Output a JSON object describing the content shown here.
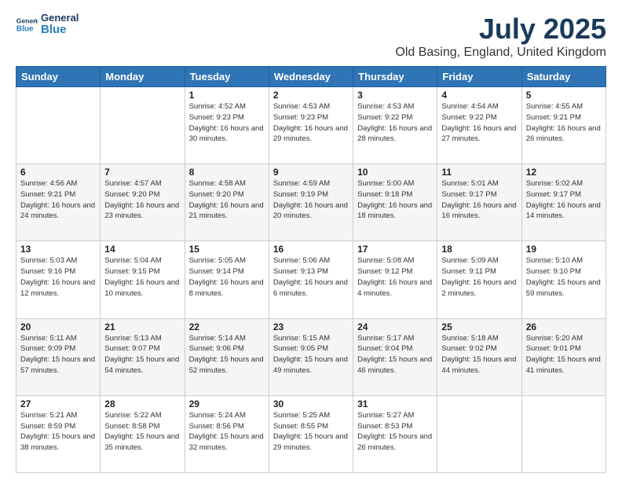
{
  "logo": {
    "line1": "General",
    "line2": "Blue"
  },
  "title": "July 2025",
  "subtitle": "Old Basing, England, United Kingdom",
  "weekdays": [
    "Sunday",
    "Monday",
    "Tuesday",
    "Wednesday",
    "Thursday",
    "Friday",
    "Saturday"
  ],
  "weeks": [
    [
      {
        "day": "",
        "info": ""
      },
      {
        "day": "",
        "info": ""
      },
      {
        "day": "1",
        "info": "Sunrise: 4:52 AM\nSunset: 9:23 PM\nDaylight: 16 hours and 30 minutes."
      },
      {
        "day": "2",
        "info": "Sunrise: 4:53 AM\nSunset: 9:23 PM\nDaylight: 16 hours and 29 minutes."
      },
      {
        "day": "3",
        "info": "Sunrise: 4:53 AM\nSunset: 9:22 PM\nDaylight: 16 hours and 28 minutes."
      },
      {
        "day": "4",
        "info": "Sunrise: 4:54 AM\nSunset: 9:22 PM\nDaylight: 16 hours and 27 minutes."
      },
      {
        "day": "5",
        "info": "Sunrise: 4:55 AM\nSunset: 9:21 PM\nDaylight: 16 hours and 26 minutes."
      }
    ],
    [
      {
        "day": "6",
        "info": "Sunrise: 4:56 AM\nSunset: 9:21 PM\nDaylight: 16 hours and 24 minutes."
      },
      {
        "day": "7",
        "info": "Sunrise: 4:57 AM\nSunset: 9:20 PM\nDaylight: 16 hours and 23 minutes."
      },
      {
        "day": "8",
        "info": "Sunrise: 4:58 AM\nSunset: 9:20 PM\nDaylight: 16 hours and 21 minutes."
      },
      {
        "day": "9",
        "info": "Sunrise: 4:59 AM\nSunset: 9:19 PM\nDaylight: 16 hours and 20 minutes."
      },
      {
        "day": "10",
        "info": "Sunrise: 5:00 AM\nSunset: 9:18 PM\nDaylight: 16 hours and 18 minutes."
      },
      {
        "day": "11",
        "info": "Sunrise: 5:01 AM\nSunset: 9:17 PM\nDaylight: 16 hours and 16 minutes."
      },
      {
        "day": "12",
        "info": "Sunrise: 5:02 AM\nSunset: 9:17 PM\nDaylight: 16 hours and 14 minutes."
      }
    ],
    [
      {
        "day": "13",
        "info": "Sunrise: 5:03 AM\nSunset: 9:16 PM\nDaylight: 16 hours and 12 minutes."
      },
      {
        "day": "14",
        "info": "Sunrise: 5:04 AM\nSunset: 9:15 PM\nDaylight: 16 hours and 10 minutes."
      },
      {
        "day": "15",
        "info": "Sunrise: 5:05 AM\nSunset: 9:14 PM\nDaylight: 16 hours and 8 minutes."
      },
      {
        "day": "16",
        "info": "Sunrise: 5:06 AM\nSunset: 9:13 PM\nDaylight: 16 hours and 6 minutes."
      },
      {
        "day": "17",
        "info": "Sunrise: 5:08 AM\nSunset: 9:12 PM\nDaylight: 16 hours and 4 minutes."
      },
      {
        "day": "18",
        "info": "Sunrise: 5:09 AM\nSunset: 9:11 PM\nDaylight: 16 hours and 2 minutes."
      },
      {
        "day": "19",
        "info": "Sunrise: 5:10 AM\nSunset: 9:10 PM\nDaylight: 15 hours and 59 minutes."
      }
    ],
    [
      {
        "day": "20",
        "info": "Sunrise: 5:11 AM\nSunset: 9:09 PM\nDaylight: 15 hours and 57 minutes."
      },
      {
        "day": "21",
        "info": "Sunrise: 5:13 AM\nSunset: 9:07 PM\nDaylight: 15 hours and 54 minutes."
      },
      {
        "day": "22",
        "info": "Sunrise: 5:14 AM\nSunset: 9:06 PM\nDaylight: 15 hours and 52 minutes."
      },
      {
        "day": "23",
        "info": "Sunrise: 5:15 AM\nSunset: 9:05 PM\nDaylight: 15 hours and 49 minutes."
      },
      {
        "day": "24",
        "info": "Sunrise: 5:17 AM\nSunset: 9:04 PM\nDaylight: 15 hours and 46 minutes."
      },
      {
        "day": "25",
        "info": "Sunrise: 5:18 AM\nSunset: 9:02 PM\nDaylight: 15 hours and 44 minutes."
      },
      {
        "day": "26",
        "info": "Sunrise: 5:20 AM\nSunset: 9:01 PM\nDaylight: 15 hours and 41 minutes."
      }
    ],
    [
      {
        "day": "27",
        "info": "Sunrise: 5:21 AM\nSunset: 8:59 PM\nDaylight: 15 hours and 38 minutes."
      },
      {
        "day": "28",
        "info": "Sunrise: 5:22 AM\nSunset: 8:58 PM\nDaylight: 15 hours and 35 minutes."
      },
      {
        "day": "29",
        "info": "Sunrise: 5:24 AM\nSunset: 8:56 PM\nDaylight: 15 hours and 32 minutes."
      },
      {
        "day": "30",
        "info": "Sunrise: 5:25 AM\nSunset: 8:55 PM\nDaylight: 15 hours and 29 minutes."
      },
      {
        "day": "31",
        "info": "Sunrise: 5:27 AM\nSunset: 8:53 PM\nDaylight: 15 hours and 26 minutes."
      },
      {
        "day": "",
        "info": ""
      },
      {
        "day": "",
        "info": ""
      }
    ]
  ]
}
